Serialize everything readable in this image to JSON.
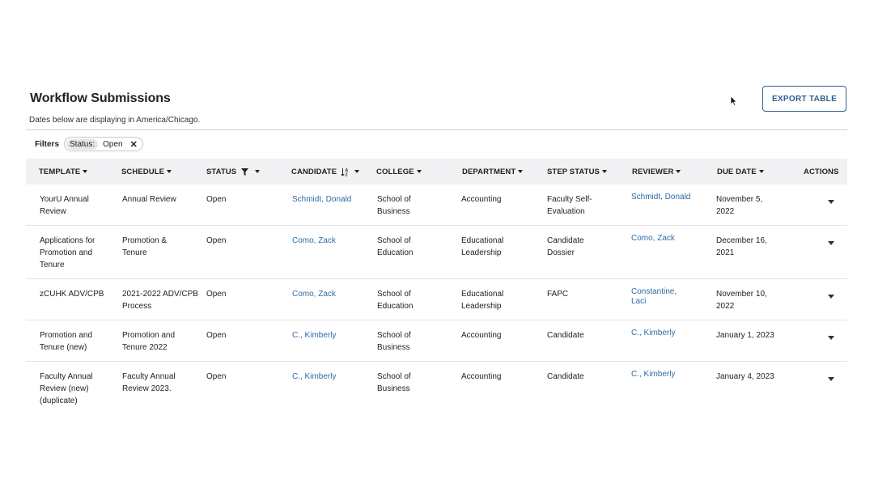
{
  "page": {
    "title": "Workflow Submissions",
    "timezone_note": "Dates below are displaying in America/Chicago.",
    "export_label": "EXPORT TABLE"
  },
  "filters": {
    "label": "Filters",
    "chips": [
      {
        "key": "Status:",
        "value": "Open",
        "remove_icon": "close-icon"
      }
    ]
  },
  "table": {
    "columns": [
      {
        "label": "TEMPLATE",
        "icon": "chevron-down-icon"
      },
      {
        "label": "SCHEDULE",
        "icon": "chevron-down-icon"
      },
      {
        "label": "STATUS",
        "icon": "filter-icon"
      },
      {
        "label": "CANDIDATE",
        "icon": "sort-ascending-icon"
      },
      {
        "label": "COLLEGE",
        "icon": "chevron-down-icon"
      },
      {
        "label": "DEPARTMENT",
        "icon": "chevron-down-icon"
      },
      {
        "label": "STEP STATUS",
        "icon": "chevron-down-icon"
      },
      {
        "label": "REVIEWER",
        "icon": "chevron-down-icon"
      },
      {
        "label": "DUE DATE",
        "icon": "chevron-down-icon"
      },
      {
        "label": "ACTIONS",
        "icon": ""
      }
    ],
    "rows": [
      {
        "template": "YourU Annual Review",
        "schedule": "Annual Review",
        "status": "Open",
        "candidate": "Schmidt, Donald",
        "college": "School of Business",
        "department": "Accounting",
        "step_status": "Faculty Self-Evaluation",
        "reviewer": "Schmidt, Donald",
        "due_date": "November 5, 2022"
      },
      {
        "template": "Applications for Promotion and Tenure",
        "schedule": "Promotion & Tenure",
        "status": "Open",
        "candidate": "Como, Zack",
        "college": "School of Education",
        "department": "Educational Leadership",
        "step_status": "Candidate Dossier",
        "reviewer": "Como, Zack",
        "due_date": "December 16, 2021"
      },
      {
        "template": "zCUHK ADV/CPB",
        "schedule": "2021-2022 ADV/CPB Process",
        "status": "Open",
        "candidate": "Como, Zack",
        "college": "School of Education",
        "department": "Educational Leadership",
        "step_status": "FAPC",
        "reviewer": "Constantine, Laci",
        "due_date": "November 10, 2022"
      },
      {
        "template": "Promotion and Tenure (new)",
        "schedule": "Promotion and Tenure 2022",
        "status": "Open",
        "candidate": "C., Kimberly",
        "college": "School of Business",
        "department": "Accounting",
        "step_status": "Candidate",
        "reviewer": "C., Kimberly",
        "due_date": "January 1, 2023"
      },
      {
        "template": "Faculty Annual Review (new) (duplicate)",
        "schedule": "Faculty Annual Review 2023.",
        "status": "Open",
        "candidate": "C., Kimberly",
        "college": "School of Business",
        "department": "Accounting",
        "step_status": "Candidate",
        "reviewer": "C., Kimberly",
        "due_date": "January 4, 2023"
      }
    ]
  },
  "colors": {
    "accent": "#2b5f91",
    "link": "#2f6aa3",
    "header_bg": "#f1f1f3"
  }
}
